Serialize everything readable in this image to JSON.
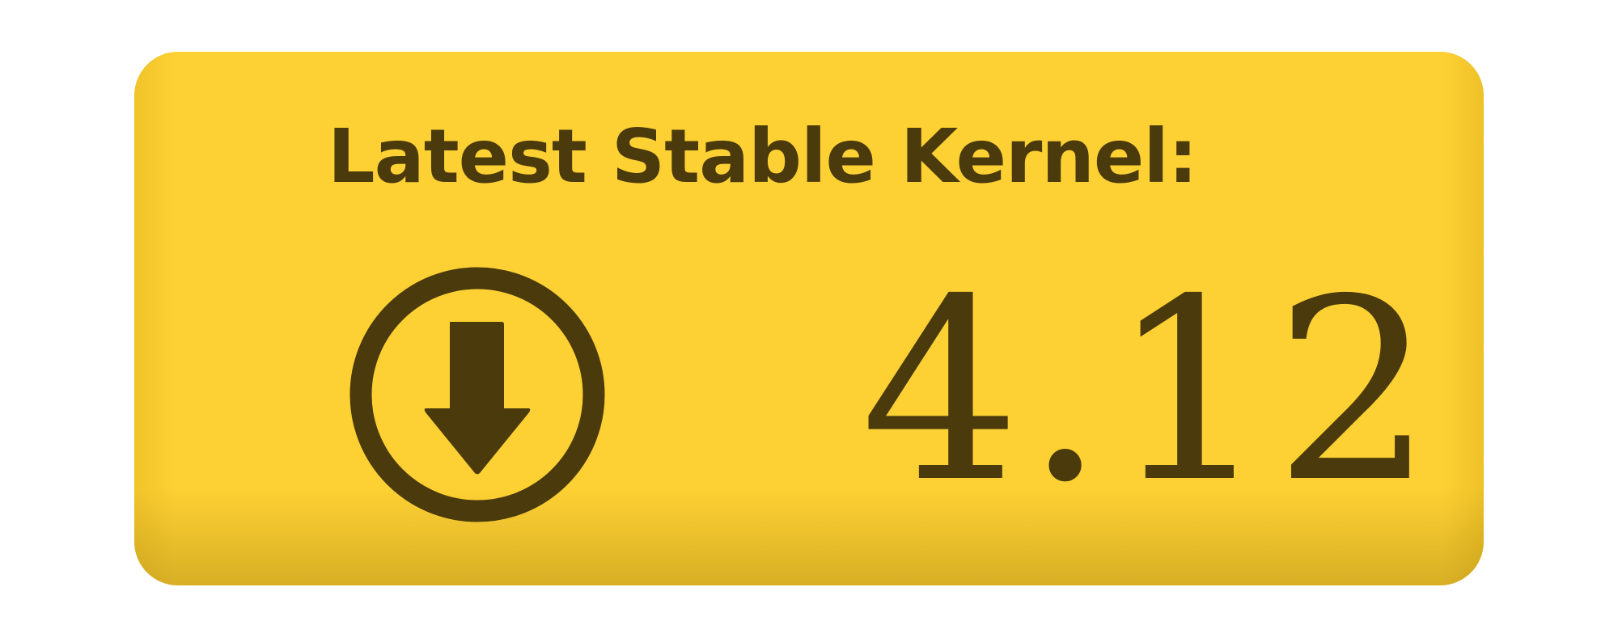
{
  "banner": {
    "title": "Latest Stable Kernel:",
    "version": "4.12",
    "icon": "download-arrow-circle-icon",
    "background_color": "#fdd033",
    "text_color": "#4a3a0c"
  }
}
